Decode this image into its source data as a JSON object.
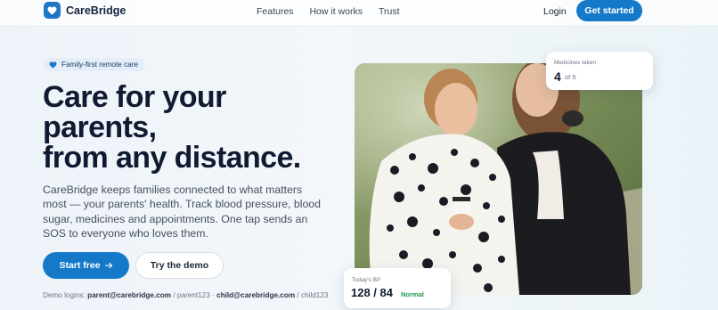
{
  "brand": {
    "name": "CareBridge",
    "accent": "#1579c9",
    "logo_icon": "heart-icon"
  },
  "nav": {
    "links": [
      "Features",
      "How it works",
      "Trust"
    ],
    "login": "Login",
    "cta": "Get started"
  },
  "hero": {
    "badge": "Family-first remote care",
    "badge_icon": "heart-icon",
    "headline_lines": [
      "Care for your",
      "parents,",
      "from any distance."
    ],
    "lede": "CareBridge keeps families connected to what matters most — your parents' health. Track blood pressure, blood sugar, medicines and appointments. One tap sends an SOS to everyone who loves them.",
    "primary_button": "Start free",
    "primary_icon": "arrow-right-icon",
    "secondary_button": "Try the demo",
    "demo": {
      "prefix": "Demo logins:",
      "parent_email": "parent@carebridge.com",
      "parent_pass": "/ parent123 ·",
      "child_email": "child@carebridge.com",
      "child_pass": "/ child123"
    }
  },
  "cards": {
    "medicines": {
      "label": "Medicines taken",
      "taken": "4",
      "of_total": "of 5"
    },
    "bp": {
      "label": "Today's BP",
      "value": "128 / 84",
      "status": "Normal",
      "status_color": "#1a9a4e"
    }
  }
}
